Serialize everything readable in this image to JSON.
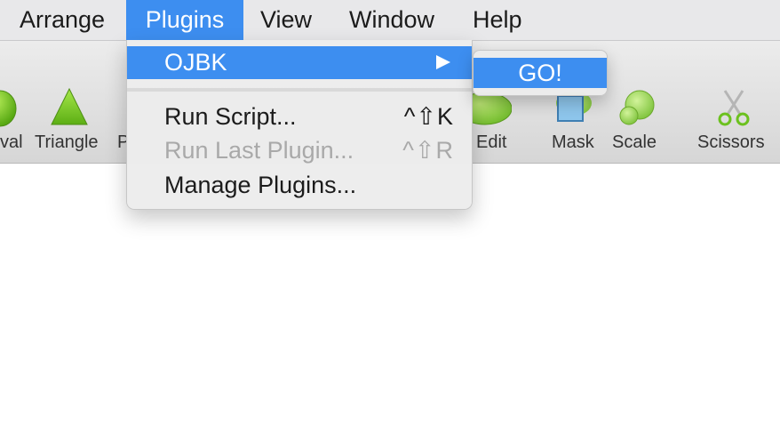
{
  "menubar": {
    "items": [
      {
        "label": "Arrange"
      },
      {
        "label": "Plugins"
      },
      {
        "label": "View"
      },
      {
        "label": "Window"
      },
      {
        "label": "Help"
      }
    ]
  },
  "toolbar": {
    "tools": [
      {
        "label": "val",
        "icon": "oval-icon"
      },
      {
        "label": "Triangle",
        "icon": "triangle-icon"
      },
      {
        "label": "P",
        "icon": "polygon-icon"
      },
      {
        "label": "Edit",
        "icon": "edit-icon"
      },
      {
        "label": "Mask",
        "icon": "mask-icon"
      },
      {
        "label": "Scale",
        "icon": "scale-icon"
      },
      {
        "label": "Scissors",
        "icon": "scissors-icon"
      }
    ]
  },
  "plugins_menu": {
    "items": [
      {
        "label": "OJBK",
        "highlighted": true
      },
      {
        "label": "Run Script...",
        "shortcut": "^⇧K"
      },
      {
        "label": "Run Last Plugin...",
        "shortcut": "^⇧R",
        "disabled": true
      },
      {
        "label": "Manage Plugins..."
      }
    ]
  },
  "submenu": {
    "items": [
      {
        "label": "GO!"
      }
    ]
  },
  "colors": {
    "highlight": "#3d8ef0",
    "menubar_bg": "#e8e8ea",
    "toolbar_bg": "#dcdcdc",
    "tool_green": "#6cc11f"
  }
}
